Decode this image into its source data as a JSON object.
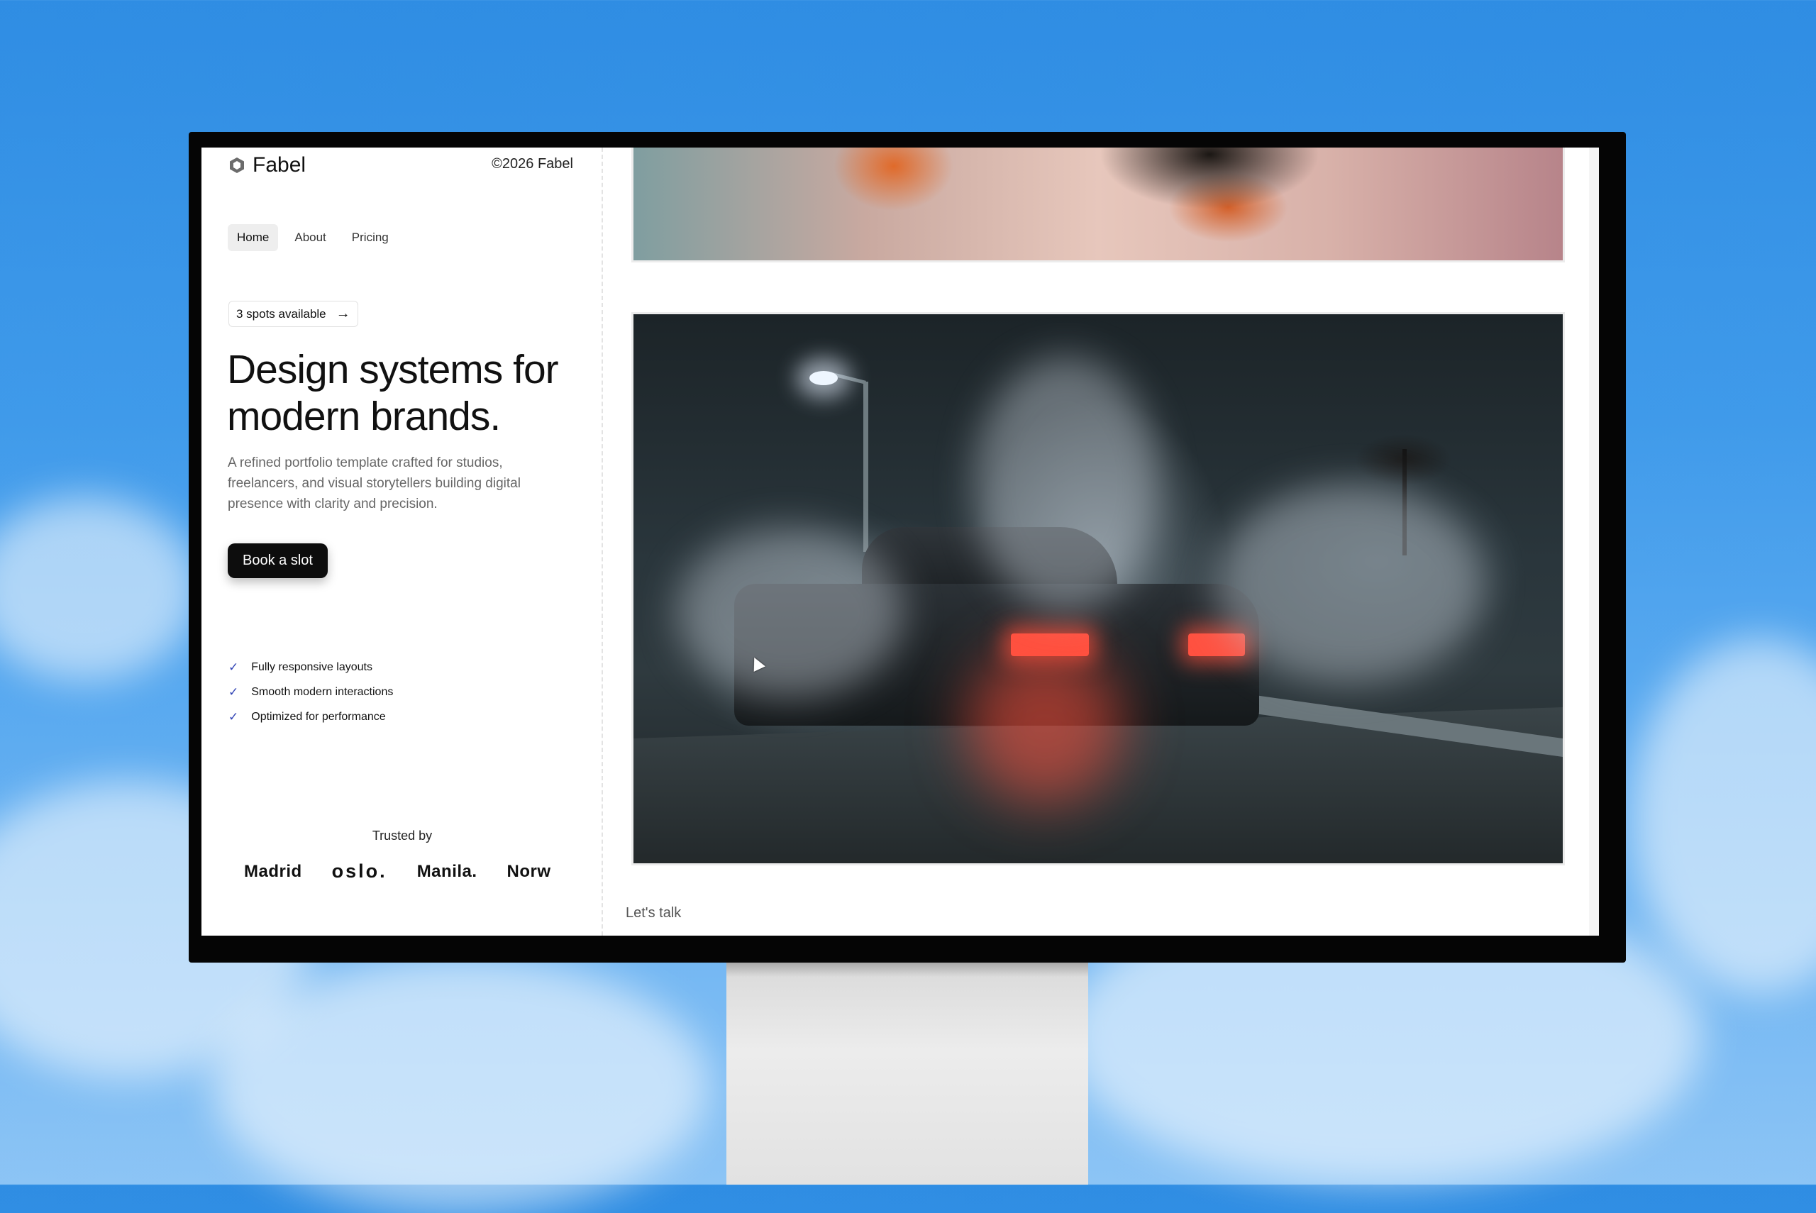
{
  "colors": {
    "sky": "#3f9aea",
    "page_bg": "#ffffff",
    "cta_bg": "#0d0d0d",
    "check_color": "#3245b5"
  },
  "header": {
    "logo_icon": "hexagon-logo-icon",
    "logo_text": "Fabel",
    "copyright": "©2026 Fabel"
  },
  "nav": {
    "items": [
      {
        "label": "Home",
        "active": true
      },
      {
        "label": "About",
        "active": false
      },
      {
        "label": "Pricing",
        "active": false
      }
    ]
  },
  "hero": {
    "badge_text": "3 spots available",
    "badge_icon": "arrow-right-icon",
    "headline": "Design systems for modern brands.",
    "description": "A refined portfolio template crafted for studios, freelancers, and visual storytellers building digital presence with clarity and precision.",
    "cta_label": "Book a slot"
  },
  "features": {
    "icon": "check-icon",
    "items": [
      "Fully responsive layouts",
      "Smooth modern interactions",
      "Optimized for performance"
    ]
  },
  "trusted": {
    "label": "Trusted by",
    "brands": [
      "Madrid",
      "oslo.",
      "Manila.",
      "Norw"
    ]
  },
  "footer": {
    "lets_talk": "Let's talk"
  }
}
